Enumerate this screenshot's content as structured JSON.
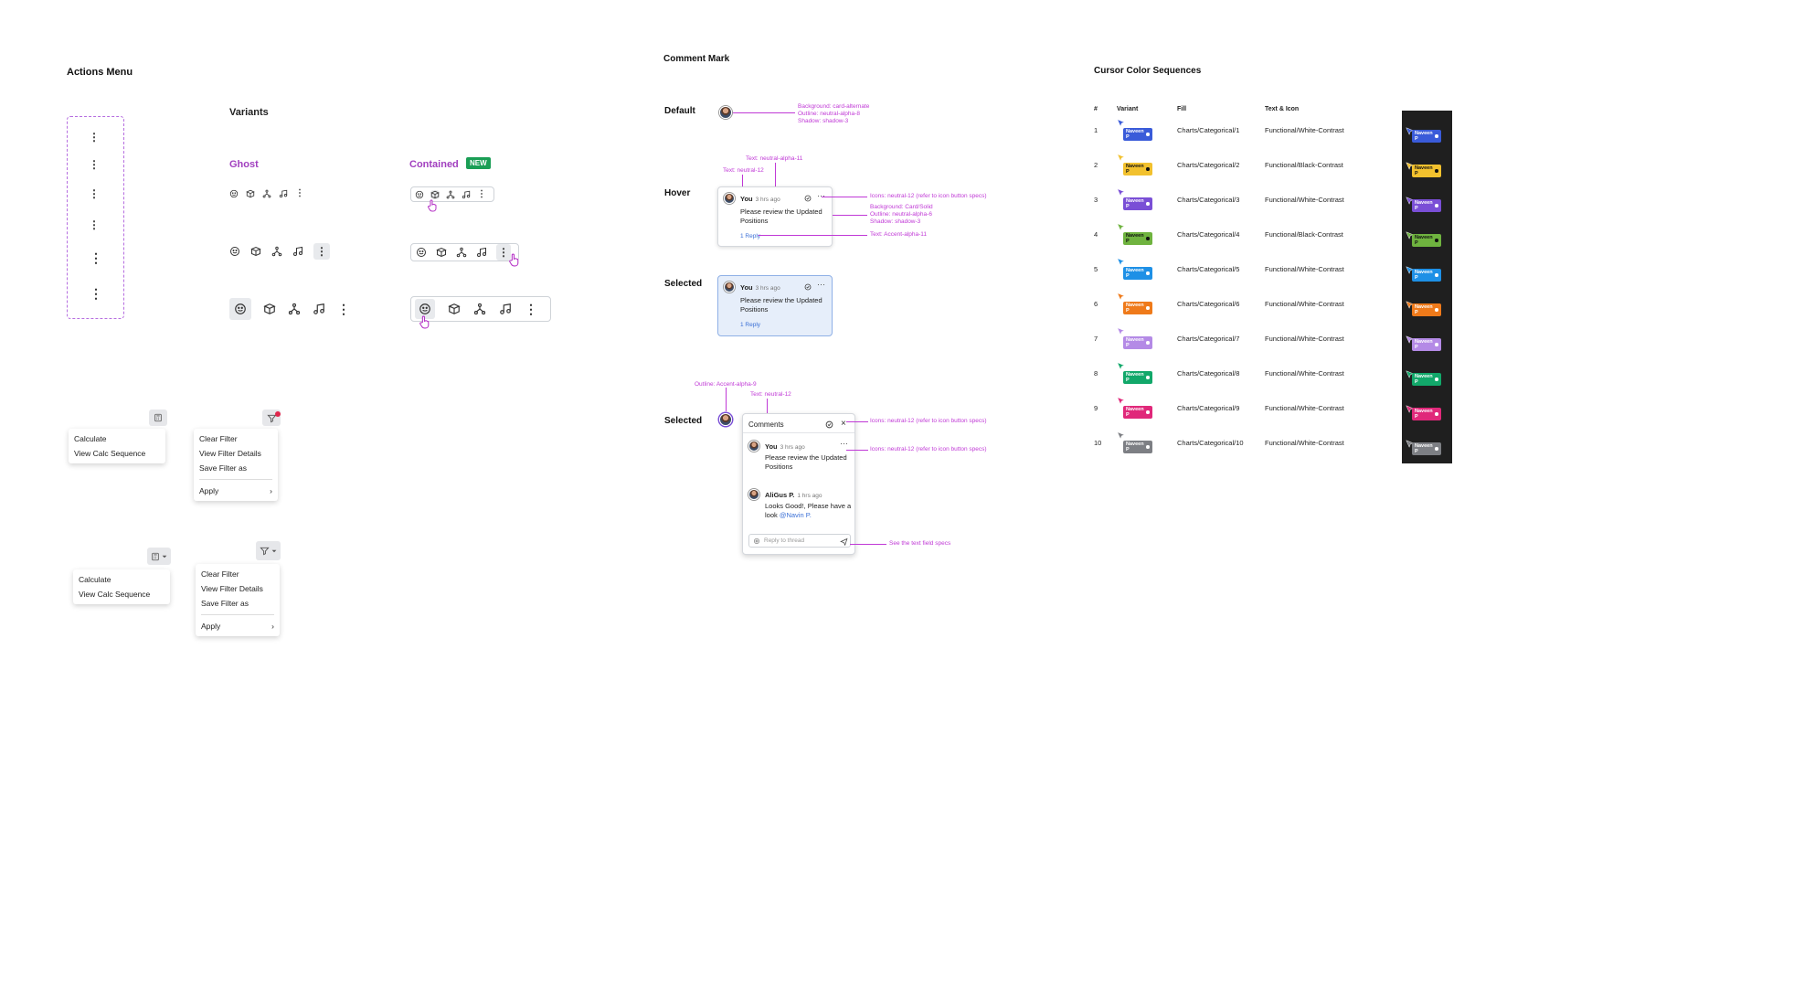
{
  "actions_menu": {
    "title": "Actions Menu",
    "variants_title": "Variants",
    "ghost_label": "Ghost",
    "contained_label": "Contained",
    "new_badge": "NEW",
    "kebab_glyph": "⋮",
    "icons": [
      "emoji-icon",
      "package-icon",
      "hierarchy-icon",
      "music-icon",
      "more-vertical-icon"
    ]
  },
  "dropdowns": {
    "calc_menu": [
      "Calculate",
      "View Calc Sequence"
    ],
    "filter_menu": [
      "Clear Filter",
      "View Filter Details",
      "Save Filter as"
    ],
    "apply_label": "Apply",
    "chevron": "›"
  },
  "comment_mark": {
    "title": "Comment Mark",
    "states": {
      "default": "Default",
      "hover": "Hover",
      "selected": "Selected",
      "selected2": "Selected"
    },
    "default_annotation": [
      "Background: card-alternate",
      "Outline: neutral-alpha-8",
      "Shadow: shadow-3"
    ],
    "hover_annotations": {
      "text_top": "Text: neutral-alpha-11",
      "text_left": "Text: neutral-12",
      "icons": "Icons: neutral-12 (refer to icon button specs)",
      "background": [
        "Background: Card/Solid",
        "Outline: neutral-alpha-6",
        "Shadow: shadow-3"
      ],
      "reply": "Text: Accent-alpha-11"
    },
    "card": {
      "author": "You",
      "time": "3 hrs ago",
      "message": "Please review the Updated Positions",
      "reply_count": "1 Reply"
    },
    "thread": {
      "outline_anno": "Outline: Accent-alpha-9",
      "text_anno": "Text: neutral-12",
      "icons_anno_1": "Icons: neutral-12 (refer to icon button specs)",
      "icons_anno_2": "Icons: neutral-12 (refer to icon button specs)",
      "textfield_anno": "See the text field specs",
      "header": "Comments",
      "msg1_author": "You",
      "msg1_time": "3 hrs ago",
      "msg1_text": "Please review the Updated Positions",
      "msg2_author": "AliGus P.",
      "msg2_time": "1 hrs ago",
      "msg2_text": "Looks Good!, Please have a look",
      "msg2_mention": "@Navin P.",
      "reply_placeholder": "Reply to thread"
    }
  },
  "cursor_sequences": {
    "title": "Cursor Color Sequences",
    "headers": [
      "#",
      "Variant",
      "Fill",
      "Text & Icon"
    ],
    "chip_label": "Naveen P",
    "rows": [
      {
        "n": "1",
        "fill": "Charts/Categorical/1",
        "text": "Functional/White-Contrast",
        "color": "#3a5bd9",
        "fg": "#ffffff"
      },
      {
        "n": "2",
        "fill": "Charts/Categorical/2",
        "text": "Functional/Black-Contrast",
        "color": "#f2c12e",
        "fg": "#111111"
      },
      {
        "n": "3",
        "fill": "Charts/Categorical/3",
        "text": "Functional/White-Contrast",
        "color": "#7a4fd6",
        "fg": "#ffffff"
      },
      {
        "n": "4",
        "fill": "Charts/Categorical/4",
        "text": "Functional/Black-Contrast",
        "color": "#6fb33f",
        "fg": "#111111"
      },
      {
        "n": "5",
        "fill": "Charts/Categorical/5",
        "text": "Functional/White-Contrast",
        "color": "#1e90e6",
        "fg": "#ffffff"
      },
      {
        "n": "6",
        "fill": "Charts/Categorical/6",
        "text": "Functional/White-Contrast",
        "color": "#ef7a1a",
        "fg": "#ffffff"
      },
      {
        "n": "7",
        "fill": "Charts/Categorical/7",
        "text": "Functional/White-Contrast",
        "color": "#b48ae6",
        "fg": "#ffffff"
      },
      {
        "n": "8",
        "fill": "Charts/Categorical/8",
        "text": "Functional/White-Contrast",
        "color": "#12a86a",
        "fg": "#ffffff"
      },
      {
        "n": "9",
        "fill": "Charts/Categorical/9",
        "text": "Functional/White-Contrast",
        "color": "#e0287a",
        "fg": "#ffffff"
      },
      {
        "n": "10",
        "fill": "Charts/Categorical/10",
        "text": "Functional/White-Contrast",
        "color": "#7d7f84",
        "fg": "#ffffff"
      }
    ]
  },
  "colors": {
    "accent_purple": "#a13fbf",
    "annotation": "#c039d6",
    "new_badge": "#1a9e55"
  }
}
